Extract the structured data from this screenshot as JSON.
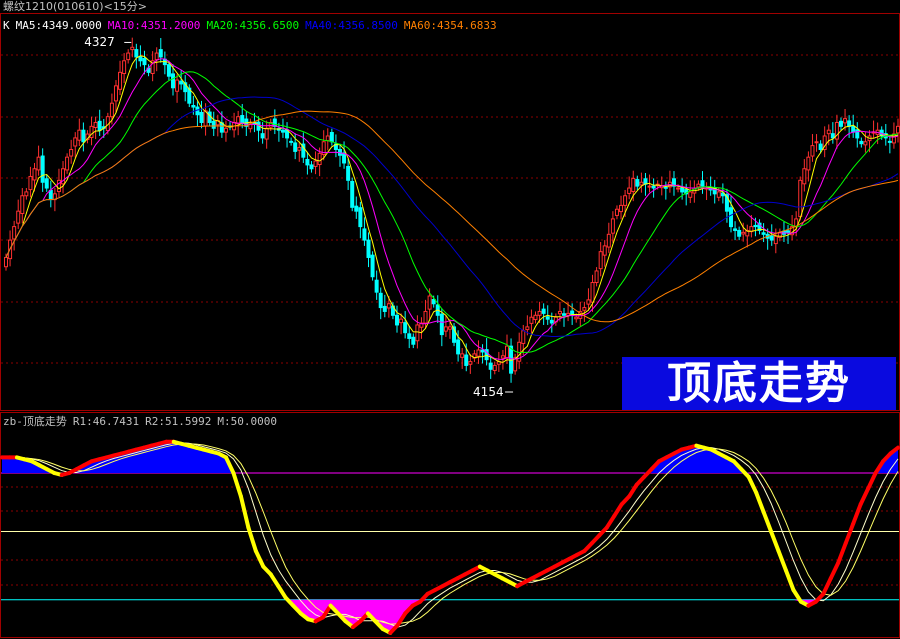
{
  "window": {
    "title": "螺纹1210(010610)<15分>"
  },
  "main_legend": [
    {
      "text": "K",
      "color": "#ffffff"
    },
    {
      "text": "MA5:4349.0000",
      "color": "#ffffff"
    },
    {
      "text": "MA10:4351.2000",
      "color": "#ff00ff"
    },
    {
      "text": "MA20:4356.6500",
      "color": "#00ff00"
    },
    {
      "text": "MA40:4356.8500",
      "color": "#0000ff"
    },
    {
      "text": "MA60:4354.6833",
      "color": "#ff8000"
    }
  ],
  "sub_legend": [
    {
      "text": "zb-顶底走势",
      "color": "#c0c0c0"
    },
    {
      "text": "R1:46.7431",
      "color": "#c0c0c0"
    },
    {
      "text": "R2:51.5992",
      "color": "#c0c0c0"
    },
    {
      "text": "M:50.0000",
      "color": "#c0c0c0"
    }
  ],
  "banner": {
    "text": "顶底走势"
  },
  "colors": {
    "up": "#ff3030",
    "down": "#00ffff",
    "grid": "#8b0000",
    "ma5": "#ffff00",
    "ma10": "#ff00ff",
    "ma20": "#00ff00",
    "ma40": "#0000cc",
    "ma60": "#ff8000",
    "top_fill": "#0000ff",
    "bottom_fill": "#ff00ff",
    "osc_up": "#ff0000",
    "osc_down": "#ffff00",
    "ref_line": "#ffffaa"
  },
  "chart_data": [
    {
      "type": "candlestick",
      "title": "螺纹1210(010610)<15分>",
      "ylim": [
        4140,
        4335
      ],
      "annotations": [
        {
          "label": "4327",
          "index": 31,
          "value": 4327
        },
        {
          "label": "4154",
          "index": 124,
          "value": 4154
        }
      ],
      "closes": [
        4216,
        4225,
        4232,
        4240,
        4248,
        4250,
        4258,
        4262,
        4268,
        4255,
        4252,
        4246,
        4249,
        4256,
        4262,
        4268,
        4272,
        4278,
        4282,
        4276,
        4280,
        4284,
        4286,
        4282,
        4283,
        4289,
        4296,
        4305,
        4312,
        4318,
        4322,
        4325,
        4320,
        4318,
        4316,
        4312,
        4318,
        4322,
        4320,
        4316,
        4310,
        4304,
        4308,
        4306,
        4302,
        4296,
        4294,
        4290,
        4286,
        4292,
        4286,
        4283,
        4287,
        4281,
        4283,
        4284,
        4286,
        4289,
        4286,
        4284,
        4286,
        4285,
        4282,
        4278,
        4283,
        4286,
        4284,
        4282,
        4281,
        4278,
        4276,
        4271,
        4273,
        4268,
        4264,
        4262,
        4266,
        4270,
        4276,
        4279,
        4276,
        4272,
        4269,
        4265,
        4256,
        4242,
        4240,
        4232,
        4225,
        4216,
        4206,
        4198,
        4190,
        4188,
        4192,
        4186,
        4181,
        4184,
        4177,
        4174,
        4171,
        4181,
        4182,
        4188,
        4196,
        4192,
        4186,
        4176,
        4180,
        4180,
        4172,
        4166,
        4166,
        4160,
        4162,
        4166,
        4168,
        4167,
        4163,
        4158,
        4160,
        4162,
        4165,
        4170,
        4156,
        4164,
        4172,
        4178,
        4180,
        4185,
        4186,
        4188,
        4187,
        4184,
        4182,
        4185,
        4188,
        4186,
        4187,
        4186,
        4185,
        4188,
        4190,
        4194,
        4203,
        4209,
        4219,
        4222,
        4228,
        4236,
        4241,
        4243,
        4248,
        4252,
        4257,
        4253,
        4255,
        4254,
        4253,
        4252,
        4254,
        4253,
        4252,
        4255,
        4253,
        4252,
        4250,
        4249,
        4250,
        4252,
        4254,
        4253,
        4252,
        4251,
        4249,
        4250,
        4248,
        4240,
        4232,
        4230,
        4227,
        4229,
        4230,
        4232,
        4232,
        4230,
        4228,
        4226,
        4225,
        4227,
        4229,
        4228,
        4229,
        4232,
        4236,
        4256,
        4262,
        4268,
        4274,
        4276,
        4272,
        4279,
        4282,
        4278,
        4286,
        4284,
        4288,
        4284,
        4281,
        4278,
        4275,
        4276,
        4279,
        4281,
        4282,
        4279,
        4278,
        4276,
        4280,
        4284
      ],
      "series": [
        {
          "name": "MA5",
          "color": "#ffff00"
        },
        {
          "name": "MA10",
          "color": "#ff00ff"
        },
        {
          "name": "MA20",
          "color": "#00ff00"
        },
        {
          "name": "MA40",
          "color": "#0000cc"
        },
        {
          "name": "MA60",
          "color": "#ff8000"
        }
      ]
    },
    {
      "type": "line",
      "title": "zb-顶底走势",
      "ylim": [
        0,
        100
      ],
      "reference_lines": [
        80,
        50,
        15
      ],
      "series": [
        {
          "name": "R1",
          "values": [
            88,
            88,
            88,
            87,
            86,
            84,
            82,
            80,
            79,
            80,
            82,
            84,
            86,
            87,
            88,
            89,
            90,
            91,
            92,
            93,
            94,
            95,
            96,
            96,
            95,
            94,
            93,
            92,
            91,
            90,
            88,
            80,
            68,
            52,
            40,
            32,
            28,
            22,
            16,
            12,
            8,
            5,
            4,
            6,
            12,
            8,
            4,
            1,
            4,
            8,
            4,
            0,
            -2,
            2,
            8,
            12,
            14,
            18,
            20,
            22,
            24,
            26,
            28,
            30,
            32,
            30,
            28,
            26,
            24,
            22,
            24,
            26,
            28,
            30,
            32,
            34,
            36,
            38,
            40,
            44,
            48,
            52,
            58,
            64,
            68,
            74,
            78,
            82,
            86,
            88,
            90,
            92,
            93,
            94,
            93,
            92,
            90,
            88,
            86,
            82,
            78,
            70,
            60,
            50,
            40,
            30,
            20,
            14,
            12,
            14,
            18,
            26,
            34,
            44,
            54,
            64,
            72,
            80,
            86,
            90,
            93
          ]
        },
        {
          "name": "R2",
          "values": []
        },
        {
          "name": "M",
          "values": []
        }
      ]
    }
  ]
}
